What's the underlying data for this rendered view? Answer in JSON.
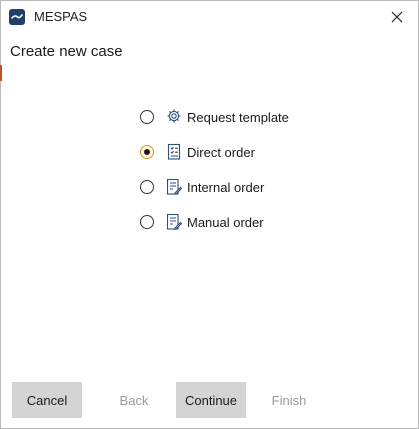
{
  "window": {
    "app_title": "MESPAS",
    "logo_icon": "mespas-logo",
    "close_icon": "close-icon"
  },
  "page": {
    "title": "Create new case"
  },
  "options": [
    {
      "label": "Request template",
      "icon": "gear-icon",
      "selected": false
    },
    {
      "label": "Direct order",
      "icon": "document-checklist-icon",
      "selected": true
    },
    {
      "label": "Internal order",
      "icon": "document-edit-icon",
      "selected": false
    },
    {
      "label": "Manual order",
      "icon": "document-edit-icon",
      "selected": false
    }
  ],
  "footer": {
    "cancel_label": "Cancel",
    "back_label": "Back",
    "continue_label": "Continue",
    "finish_label": "Finish"
  },
  "colors": {
    "logo_bg": "#1f3f66",
    "button_bg": "#d4d4d4",
    "disabled_text": "#9a9a9a",
    "radio_selected_border": "#c9a12c"
  }
}
